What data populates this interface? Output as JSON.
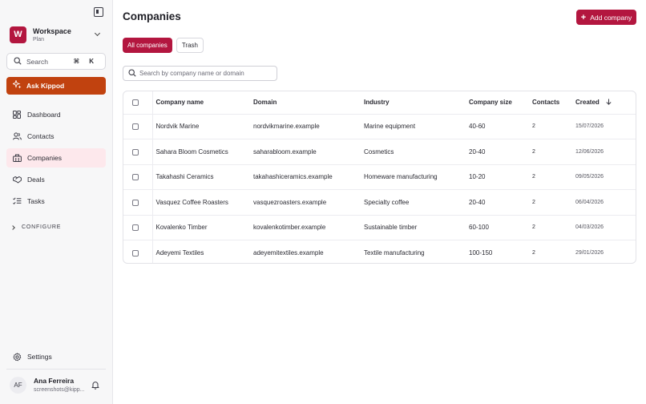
{
  "workspace": {
    "initial": "W",
    "name": "Workspace",
    "plan": "Plan"
  },
  "search": {
    "label": "Search",
    "shortcut": "⌘ K"
  },
  "ask": {
    "label": "Ask Kippod"
  },
  "nav": {
    "dashboard": "Dashboard",
    "contacts": "Contacts",
    "companies": "Companies",
    "deals": "Deals",
    "tasks": "Tasks"
  },
  "configure_label": "CONFIGURE",
  "settings_label": "Settings",
  "user": {
    "initials": "AF",
    "name": "Ana Ferreira",
    "email": "screenshots@kipp..."
  },
  "page": {
    "title": "Companies",
    "add_label": "Add company"
  },
  "tabs": {
    "all": "All companies",
    "trash": "Trash"
  },
  "filter": {
    "placeholder": "Search by company name or domain",
    "value": ""
  },
  "table": {
    "headers": {
      "name": "Company name",
      "domain": "Domain",
      "industry": "Industry",
      "size": "Company size",
      "contacts": "Contacts",
      "created": "Created"
    },
    "rows": [
      {
        "name": "Nordvik Marine",
        "domain": "nordvikmarine.example",
        "industry": "Marine equipment",
        "size": "40-60",
        "contacts": "2",
        "created": "15/07/2026"
      },
      {
        "name": "Sahara Bloom Cosmetics",
        "domain": "saharabloom.example",
        "industry": "Cosmetics",
        "size": "20-40",
        "contacts": "2",
        "created": "12/06/2026"
      },
      {
        "name": "Takahashi Ceramics",
        "domain": "takahashiceramics.example",
        "industry": "Homeware manufacturing",
        "size": "10-20",
        "contacts": "2",
        "created": "09/05/2026"
      },
      {
        "name": "Vasquez Coffee Roasters",
        "domain": "vasquezroasters.example",
        "industry": "Specialty coffee",
        "size": "20-40",
        "contacts": "2",
        "created": "06/04/2026"
      },
      {
        "name": "Kovalenko Timber",
        "domain": "kovalenkotimber.example",
        "industry": "Sustainable timber",
        "size": "60-100",
        "contacts": "2",
        "created": "04/03/2026"
      },
      {
        "name": "Adeyemi Textiles",
        "domain": "adeyemitextiles.example",
        "industry": "Textile manufacturing",
        "size": "100-150",
        "contacts": "2",
        "created": "29/01/2026"
      }
    ]
  },
  "colors": {
    "brand": "#b3163f",
    "ask": "#c1420f",
    "active_nav_bg": "#fde8ec"
  }
}
